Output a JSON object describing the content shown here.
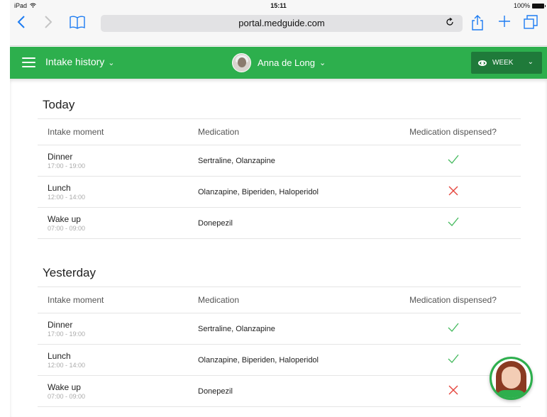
{
  "status_bar": {
    "device": "iPad",
    "time": "15:11",
    "battery": "100%"
  },
  "browser": {
    "url": "portal.medguide.com",
    "icons": [
      "back-icon",
      "forward-icon",
      "bookmarks-icon",
      "reload-icon",
      "share-icon",
      "new-tab-icon",
      "tabs-icon"
    ]
  },
  "header": {
    "title": "Intake history",
    "patient_name": "Anna de Long",
    "range_label": "WEEK",
    "accent_color": "#2daf4d"
  },
  "columns": {
    "moment": "Intake moment",
    "medication": "Medication",
    "dispensed": "Medication dispensed?"
  },
  "sections": [
    {
      "title": "Today",
      "rows": [
        {
          "moment": "Dinner",
          "time": "17:00 - 19:00",
          "medication": "Sertraline, Olanzapine",
          "dispensed": true
        },
        {
          "moment": "Lunch",
          "time": "12:00 - 14:00",
          "medication": "Olanzapine, Biperiden, Haloperidol",
          "dispensed": false
        },
        {
          "moment": "Wake up",
          "time": "07:00 - 09:00",
          "medication": "Donepezil",
          "dispensed": true
        }
      ]
    },
    {
      "title": "Yesterday",
      "rows": [
        {
          "moment": "Dinner",
          "time": "17:00 - 19:00",
          "medication": "Sertraline, Olanzapine",
          "dispensed": true
        },
        {
          "moment": "Lunch",
          "time": "12:00 - 14:00",
          "medication": "Olanzapine, Biperiden, Haloperidol",
          "dispensed": true
        },
        {
          "moment": "Wake up",
          "time": "07:00 - 09:00",
          "medication": "Donepezil",
          "dispensed": false
        }
      ]
    }
  ]
}
